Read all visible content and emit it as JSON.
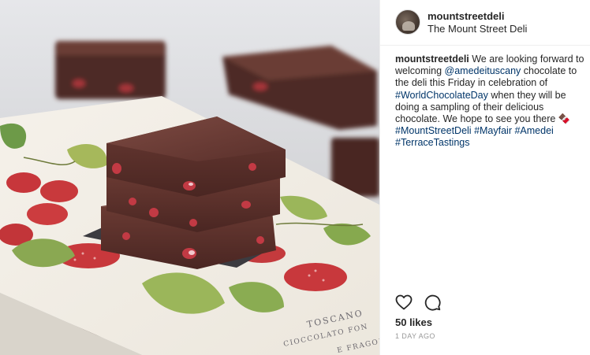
{
  "photo": {
    "alt_icon": "chocolate-stack-photo",
    "package_text_1": "TOSCANO",
    "package_text_2": "CIOCCOLATO FON",
    "package_text_3": "E FRAGOL"
  },
  "header": {
    "username": "mountstreetdeli",
    "display_name": "The Mount Street Deli",
    "avatar_icon": "avatar"
  },
  "caption": {
    "username": "mountstreetdeli",
    "t1": " We are looking forward to welcoming ",
    "mention": "@amedeituscany",
    "t2": " chocolate to the deli this Friday in celebration of ",
    "hashtag1": "#WorldChocolateDay",
    "t3": " when they will be doing a sampling of their delicious chocolate. We hope to see you there ",
    "emoji": "🍫",
    "t4": " ",
    "hashtag2": "#MountStreetDeli",
    "hashtag3": "#Mayfair",
    "hashtag4": "#Amedei",
    "hashtag5": "#TerraceTastings"
  },
  "actions": {
    "like_icon": "heart-icon",
    "comment_icon": "comment-icon"
  },
  "likes": "50 likes",
  "date": "1 DAY AGO",
  "colors": {
    "link": "#003569",
    "text": "#262626",
    "muted": "#999999",
    "border": "#efefef"
  }
}
